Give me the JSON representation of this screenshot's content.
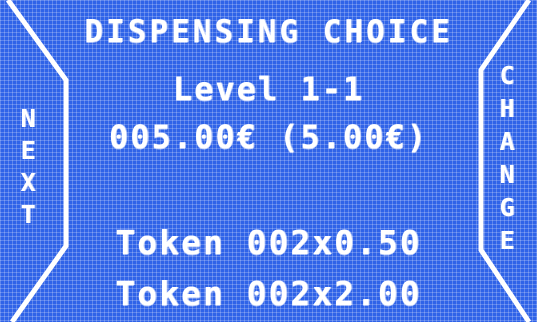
{
  "screen": {
    "title": "DISPENSING CHOICE",
    "level": "Level 1-1",
    "credit": "005.00€ (5.00€)",
    "tokens": [
      "Token 002x0.50",
      "Token 002x2.00"
    ]
  },
  "buttons": {
    "next": {
      "letters": [
        "N",
        "E",
        "X",
        "T"
      ]
    },
    "change": {
      "letters": [
        "C",
        "H",
        "A",
        "N",
        "G",
        "E"
      ]
    }
  },
  "colors": {
    "background": "#2f63e8",
    "foreground": "#ffffff"
  }
}
